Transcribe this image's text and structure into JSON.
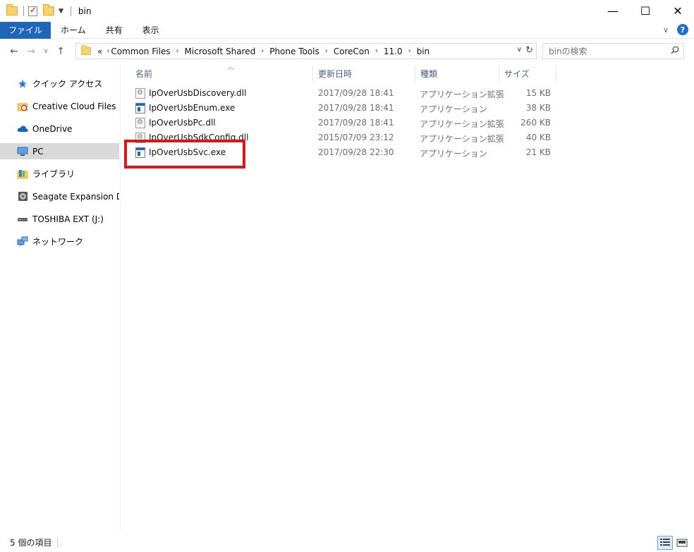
{
  "window": {
    "title": "bin",
    "buttons": {
      "minimize": "—",
      "maximize": "☐",
      "close": "✕"
    }
  },
  "ribbon": {
    "tabs": [
      "ファイル",
      "ホーム",
      "共有",
      "表示"
    ],
    "help_label": "?"
  },
  "address": {
    "breadcrumbs": [
      "«",
      "Common Files",
      "Microsoft Shared",
      "Phone Tools",
      "CoreCon",
      "11.0",
      "bin"
    ]
  },
  "search": {
    "placeholder": "binの検索"
  },
  "nav": {
    "items": [
      {
        "label": "クイック アクセス",
        "icon": "star-icon"
      },
      {
        "label": "Creative Cloud Files",
        "icon": "creative-cloud-icon"
      },
      {
        "label": "OneDrive",
        "icon": "cloud-icon"
      },
      {
        "label": "PC",
        "icon": "pc-icon",
        "selected": true
      },
      {
        "label": "ライブラリ",
        "icon": "library-icon"
      },
      {
        "label": "Seagate Expansion Drive",
        "icon": "drive-icon"
      },
      {
        "label": "TOSHIBA EXT (J:)",
        "icon": "usb-drive-icon"
      },
      {
        "label": "ネットワーク",
        "icon": "network-icon"
      }
    ]
  },
  "columns": {
    "name": "名前",
    "date": "更新日時",
    "type": "種類",
    "size": "サイズ"
  },
  "files": [
    {
      "name": "IpOverUsbDiscovery.dll",
      "date": "2017/09/28 18:41",
      "type": "アプリケーション拡張",
      "size": "15 KB",
      "kind": "dll"
    },
    {
      "name": "IpOverUsbEnum.exe",
      "date": "2017/09/28 18:41",
      "type": "アプリケーション",
      "size": "38 KB",
      "kind": "exe"
    },
    {
      "name": "IpOverUsbPc.dll",
      "date": "2017/09/28 18:41",
      "type": "アプリケーション拡張",
      "size": "260 KB",
      "kind": "dll"
    },
    {
      "name": "IpOverUsbSdkConfig.dll",
      "date": "2015/07/09 23:12",
      "type": "アプリケーション拡張",
      "size": "40 KB",
      "kind": "dll"
    },
    {
      "name": "IpOverUsbSvc.exe",
      "date": "2017/09/28 22:30",
      "type": "アプリケーション",
      "size": "21 KB",
      "kind": "exe"
    }
  ],
  "status": {
    "item_count": "5 個の項目"
  },
  "colors": {
    "file_tab": "#1e66b8",
    "highlight": "#d9161c",
    "selected_nav": "#d9d9d9"
  }
}
